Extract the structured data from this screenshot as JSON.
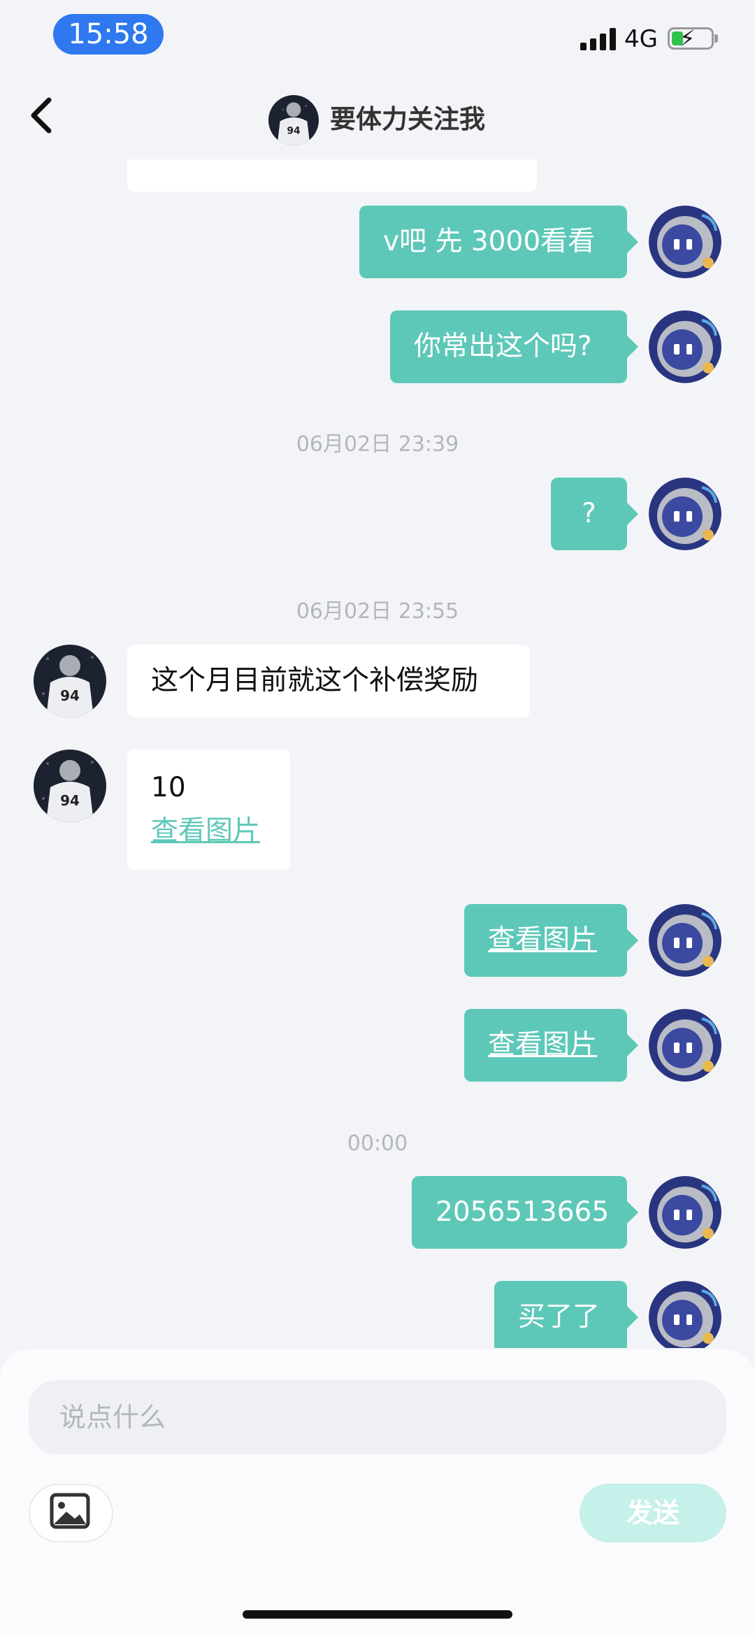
{
  "status_bar": {
    "time": "15:58",
    "network": "4G"
  },
  "header": {
    "title": "要体力关注我",
    "back_icon": "chevron-left-icon"
  },
  "messages": [
    {
      "from": "me",
      "text": "v吧 先 3000看看"
    },
    {
      "from": "me",
      "text": "你常出这个吗?"
    },
    {
      "time": "06月02日 23:39"
    },
    {
      "from": "me",
      "text": "?"
    },
    {
      "time": "06月02日 23:55"
    },
    {
      "from": "other",
      "text": "这个月目前就这个补偿奖励"
    },
    {
      "from": "other",
      "text": "10",
      "link": "查看图片"
    },
    {
      "from": "me",
      "link": "查看图片"
    },
    {
      "from": "me",
      "link": "查看图片"
    },
    {
      "time": "00:00"
    },
    {
      "from": "me",
      "text": "2056513665"
    },
    {
      "from": "me",
      "text": "买了了"
    }
  ],
  "input": {
    "placeholder": "说点什么",
    "image_icon": "image-icon",
    "send_label": "发送"
  },
  "colors": {
    "accent": "#5ec8b8",
    "send_disabled": "#c6f0ea",
    "background": "#f3f4f8",
    "time_pill": "#2f78f0"
  }
}
